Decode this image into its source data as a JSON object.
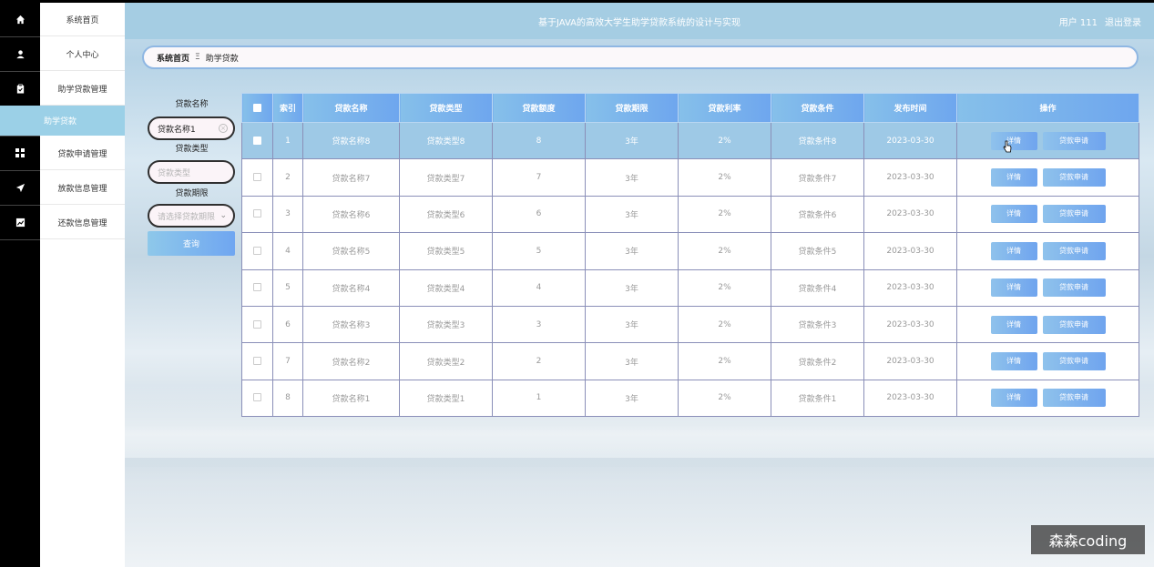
{
  "app": {
    "title": "基于JAVA的高效大学生助学贷款系统的设计与实现",
    "user_label": "用户 111",
    "logout_label": "退出登录"
  },
  "sidebar": {
    "items": [
      {
        "label": "系统首页",
        "icon": "home-icon"
      },
      {
        "label": "个人中心",
        "icon": "user-icon"
      },
      {
        "label": "助学贷款管理",
        "icon": "clipboard-icon"
      },
      {
        "label": "贷款申请管理",
        "icon": "grid-icon"
      },
      {
        "label": "放款信息管理",
        "icon": "send-icon"
      },
      {
        "label": "还款信息管理",
        "icon": "chart-icon"
      }
    ],
    "active_item": "助学贷款"
  },
  "breadcrumb": {
    "home": "系统首页",
    "separator": "Ξ",
    "current": "助学贷款"
  },
  "search": {
    "name_label": "贷款名称",
    "name_value": "贷款名称1",
    "type_label": "贷款类型",
    "type_placeholder": "贷款类型",
    "term_label": "贷款期限",
    "term_placeholder": "请选择贷款期限",
    "button_label": "查询"
  },
  "table": {
    "headers": [
      "索引",
      "贷款名称",
      "贷款类型",
      "贷款额度",
      "贷款期限",
      "贷款利率",
      "贷款条件",
      "发布时间",
      "操作"
    ],
    "detail_label": "详情",
    "apply_label": "贷款申请",
    "rows": [
      {
        "index": "1",
        "name": "贷款名称8",
        "type": "贷款类型8",
        "amount": "8",
        "term": "3年",
        "rate": "2%",
        "condition": "贷款条件8",
        "date": "2023-03-30"
      },
      {
        "index": "2",
        "name": "贷款名称7",
        "type": "贷款类型7",
        "amount": "7",
        "term": "3年",
        "rate": "2%",
        "condition": "贷款条件7",
        "date": "2023-03-30"
      },
      {
        "index": "3",
        "name": "贷款名称6",
        "type": "贷款类型6",
        "amount": "6",
        "term": "3年",
        "rate": "2%",
        "condition": "贷款条件6",
        "date": "2023-03-30"
      },
      {
        "index": "4",
        "name": "贷款名称5",
        "type": "贷款类型5",
        "amount": "5",
        "term": "3年",
        "rate": "2%",
        "condition": "贷款条件5",
        "date": "2023-03-30"
      },
      {
        "index": "5",
        "name": "贷款名称4",
        "type": "贷款类型4",
        "amount": "4",
        "term": "3年",
        "rate": "2%",
        "condition": "贷款条件4",
        "date": "2023-03-30"
      },
      {
        "index": "6",
        "name": "贷款名称3",
        "type": "贷款类型3",
        "amount": "3",
        "term": "3年",
        "rate": "2%",
        "condition": "贷款条件3",
        "date": "2023-03-30"
      },
      {
        "index": "7",
        "name": "贷款名称2",
        "type": "贷款类型2",
        "amount": "2",
        "term": "3年",
        "rate": "2%",
        "condition": "贷款条件2",
        "date": "2023-03-30"
      },
      {
        "index": "8",
        "name": "贷款名称1",
        "type": "贷款类型1",
        "amount": "1",
        "term": "3年",
        "rate": "2%",
        "condition": "贷款条件1",
        "date": "2023-03-30"
      }
    ]
  },
  "watermark": "森森coding",
  "colors": {
    "accent": "#6fa6ee",
    "active_menu": "#9bd0e7",
    "topbar": "#a5cde3",
    "selected_row": "#9ec9e6"
  }
}
